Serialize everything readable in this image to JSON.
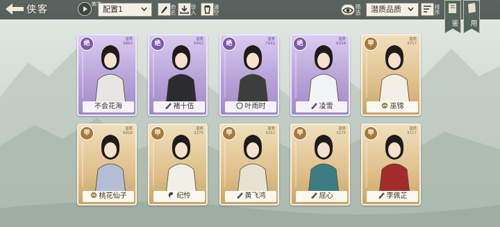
{
  "header": {
    "title": "侠客",
    "preset_button_label": "教学",
    "config": {
      "selected": "配置1"
    },
    "rename_label": "命名",
    "import_label": "导入",
    "clear_label": "清空",
    "filter_label": "筛选",
    "sort": {
      "selected": "潜质品质"
    },
    "sort_order_label": "排序",
    "atlas_label": "图鉴",
    "general_label": "通用"
  },
  "cards": [
    {
      "name": "不会花海",
      "rank": "绝",
      "stat_label": "潜质",
      "stat_value": "9863",
      "tier": "purple",
      "icon": "none"
    },
    {
      "name": "褚十伍",
      "rank": "绝",
      "stat_label": "潜质",
      "stat_value": "9452",
      "tier": "purple",
      "icon": "sword-icon"
    },
    {
      "name": "叶雨时",
      "rank": "绝",
      "stat_label": "潜质",
      "stat_value": "7931",
      "tier": "purple",
      "icon": "shield-icon"
    },
    {
      "name": "凌雪",
      "rank": "绝",
      "stat_label": "潜质",
      "stat_value": "6334",
      "tier": "purple",
      "icon": "sword-icon"
    },
    {
      "name": "巫锦",
      "rank": "甲",
      "stat_label": "潜质",
      "stat_value": "3717",
      "tier": "gold",
      "icon": "cloud-icon"
    },
    {
      "name": "桃花仙子",
      "rank": "甲",
      "stat_label": "潜质",
      "stat_value": "6816",
      "tier": "gold",
      "icon": "cloud-icon"
    },
    {
      "name": "纪怜",
      "rank": "甲",
      "stat_label": "潜质",
      "stat_value": "3275",
      "tier": "gold",
      "icon": "yin-yang-icon"
    },
    {
      "name": "黄飞鸿",
      "rank": "甲",
      "stat_label": "潜质",
      "stat_value": "3231",
      "tier": "gold",
      "icon": "sword-icon"
    },
    {
      "name": "屈心",
      "rank": "甲",
      "stat_label": "潜质",
      "stat_value": "3175",
      "tier": "gold",
      "icon": "sword-icon"
    },
    {
      "name": "李佩芷",
      "rank": "甲",
      "stat_label": "潜质",
      "stat_value": "3117",
      "tier": "gold",
      "icon": "sword-icon"
    }
  ],
  "colors": {
    "accent_purple": "#7a5ba8",
    "accent_gold": "#a87a3a",
    "topbar": "#4e5854"
  }
}
